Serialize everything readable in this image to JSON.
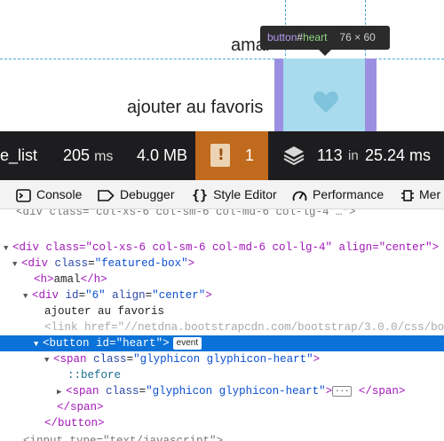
{
  "preview": {
    "name_text": "amal",
    "fav_text": "ajouter au favoris",
    "tooltip": {
      "tag": "button",
      "hash": "#",
      "id": "heart",
      "dims": "76 × 60"
    }
  },
  "perf": {
    "label": "e_list",
    "time": "205",
    "time_unit": "ms",
    "memory": "4.0 MB",
    "warnings": "1",
    "layers": "113",
    "in_word": "in",
    "total_time": "25.24 ms"
  },
  "toolbar": {
    "tabs": [
      {
        "label": "Console",
        "icon": "console-icon"
      },
      {
        "label": "Debugger",
        "icon": "debugger-icon"
      },
      {
        "label": "Style Editor",
        "icon": "style-editor-icon"
      },
      {
        "label": "Performance",
        "icon": "performance-icon"
      },
      {
        "label": "Mer",
        "icon": "memory-icon"
      }
    ]
  },
  "tree": {
    "l0": "<div class=\"col-xs-6 col-sm-6 col-md-6 col-lg-4\" align=\"center\">",
    "l1_tag": "div",
    "l1_attr": "class",
    "l1_val": "featured-box",
    "l2_tag": "h",
    "l2_text": "amal",
    "l3_tag": "div",
    "l3_id": "6",
    "l3_align": "center",
    "l4_text": "ajouter au favoris",
    "l5_tag": "link",
    "l5_attr": "href",
    "l5_val": "//netdna.bootstrapcdn.com/bootstrap/3.0.0/css/boo",
    "l6_tag": "button",
    "l6_attr": "id",
    "l6_val": "heart",
    "l6_badge": "event",
    "l7_tag": "span",
    "l7_attr": "class",
    "l7_val": "glyphicon glyphicon-heart",
    "l8_text": "::before",
    "l9_tag": "span",
    "l9_attr": "class",
    "l9_val": "glyphicon glyphicon-heart",
    "l9_ell": "···",
    "l10": "</span>",
    "l11": "</button>"
  },
  "colors": {
    "selection": "#0a72d8",
    "warning": "#c06a1d",
    "highlight_padding": "#9a8fe0",
    "highlight_content": "#a9dbee"
  }
}
